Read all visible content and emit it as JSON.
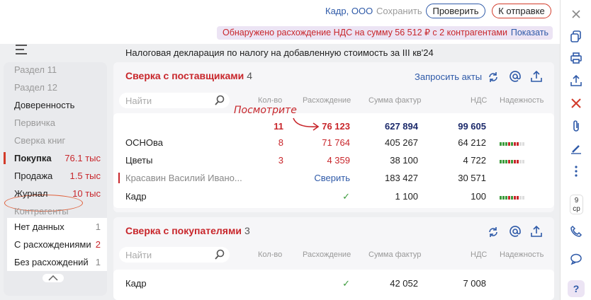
{
  "header": {
    "company": "Кадр, ООО",
    "save": "Сохранить",
    "check_button": "Проверить",
    "send_button": "К отправке",
    "alert_text": "Обнаружено расхождение НДС на сумму 56 512 ₽ с 2 контрагентами",
    "alert_link": "Показать"
  },
  "document_title": "Налоговая декларация по налогу на добавленную стоимость за III кв'24",
  "sidebar": {
    "items": [
      {
        "label": "Раздел 11"
      },
      {
        "label": "Раздел 12"
      },
      {
        "label": "Доверенность"
      },
      {
        "label": "Первичка"
      },
      {
        "label": "Сверка книг"
      },
      {
        "label": "Покупка",
        "count": "76.1 тыс"
      },
      {
        "label": "Продажа",
        "count": "1.5 тыс"
      },
      {
        "label": "Журнал",
        "count": "10 тыс"
      },
      {
        "label": "Контрагенты"
      },
      {
        "label": "Нет данных",
        "count": "1"
      },
      {
        "label": "С расхождениями",
        "count": "2"
      },
      {
        "label": "Без расхождений",
        "count": "1"
      }
    ]
  },
  "suppliers": {
    "title": "Сверка с поставщиками",
    "count": "4",
    "request_acts": "Запросить акты",
    "search_placeholder": "Найти",
    "columns": [
      "Кол-во",
      "Расхождение",
      "Сумма фактур",
      "НДС",
      "Надежность"
    ],
    "totals": {
      "qty": "11",
      "diff": "76 123",
      "sum": "627 894",
      "vat": "99 605"
    },
    "rows": [
      {
        "name": "ОСНОва",
        "qty": "8",
        "diff": "71 764",
        "sum": "405 267",
        "vat": "64 212"
      },
      {
        "name": "Цветы",
        "qty": "3",
        "diff": "4 359",
        "sum": "38 100",
        "vat": "4 722"
      },
      {
        "name": "Красавин Василий Ивано...",
        "qty": "",
        "diff": "Сверить",
        "sum": "183 427",
        "vat": "30 571"
      },
      {
        "name": "Кадр",
        "qty": "",
        "diff": "✓",
        "sum": "1 100",
        "vat": "100"
      }
    ]
  },
  "buyers": {
    "title": "Сверка с покупателями",
    "count": "3",
    "search_placeholder": "Найти",
    "columns": [
      "Кол-во",
      "Расхождение",
      "Сумма фактур",
      "НДС",
      "Надежность"
    ],
    "rows": [
      {
        "name": "Кадр",
        "qty": "",
        "diff": "✓",
        "sum": "42 052",
        "vat": "7 008"
      }
    ]
  },
  "annotation": "Посмотрите",
  "rail": {
    "day_number": "9",
    "day_name": "ср",
    "help": "?"
  }
}
